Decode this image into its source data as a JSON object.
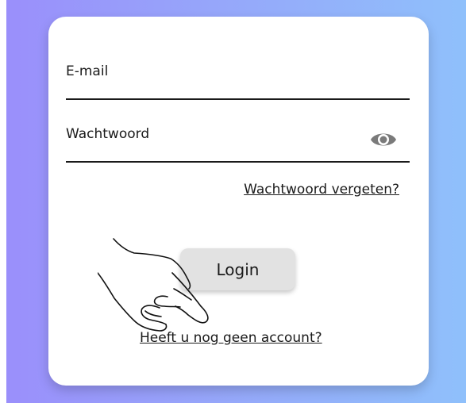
{
  "login_form": {
    "email_label": "E-mail",
    "password_label": "Wachtwoord",
    "forgot_password_link": "Wachtwoord vergeten?",
    "login_button": "Login",
    "register_link": "Heeft u nog geen account?"
  },
  "icons": {
    "password_toggle": "eye-icon",
    "cursor": "pointing-hand-icon"
  },
  "colors": {
    "gradient_start": "#9a8ffb",
    "gradient_end": "#8fc0fb",
    "card": "#ffffff",
    "button": "#e2e2e2",
    "text": "#1a1a1a",
    "icon": "#7a7a7a"
  }
}
